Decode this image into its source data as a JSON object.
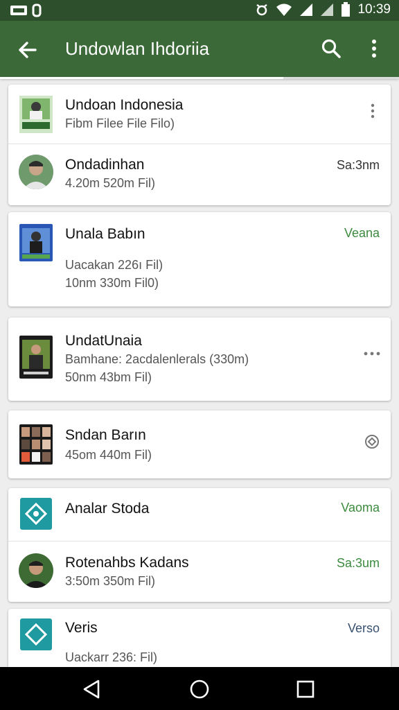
{
  "status_bar": {
    "time": "10:39",
    "icons": [
      "sim-icon",
      "sync-icon",
      "alarm-icon",
      "wifi-icon",
      "signal-icon",
      "signal-icon",
      "battery-icon"
    ]
  },
  "toolbar": {
    "title": "Undowlan Ihdoriia",
    "icons": [
      "back-arrow-icon",
      "search-icon",
      "more-vert-icon"
    ]
  },
  "progress": {
    "value": 0.71
  },
  "colors": {
    "toolbar": "#3b6a38",
    "status_bar": "#2d4f2c",
    "accent_green": "#3b8a3e",
    "accent_blue": "#37506e",
    "teal_tile": "#1f9aa0"
  },
  "cards": [
    {
      "rows": [
        {
          "title": "Undoan Indonesia",
          "sub1": "Fibm Filee File Filo)",
          "action_icon": "more-vert-icon"
        },
        {
          "title": "Ondadinhan",
          "sub1": "4.20m 520m Fil)",
          "meta": "Sa:3nm"
        }
      ]
    },
    {
      "rows": [
        {
          "title": "Unala Babın",
          "sub1": "Uacakan 226ı Fil)",
          "sub2": "10nm 330m Fil0)",
          "meta": "Veana"
        }
      ]
    },
    {
      "rows": [
        {
          "title": "UndatUnaia",
          "sub1": "Bamhane: 2acdalenlerals  (330m)",
          "sub2": "50nm 43bm Fil)",
          "action_icon": "more-horiz-icon"
        }
      ]
    },
    {
      "rows": [
        {
          "title": "Sndan Barın",
          "sub1": "45om 440m Fil)",
          "action_icon": "diamond-icon"
        }
      ]
    },
    {
      "rows": [
        {
          "title": "Analar Stoda",
          "meta": "Vaoma"
        },
        {
          "title": "Rotenahbs Kadans",
          "sub1": "3:50m 350m Fil)",
          "meta": "Sa:3um"
        }
      ]
    },
    {
      "rows": [
        {
          "title": "Veris",
          "sub1": "Uackarr 236: Fil)",
          "meta": "Verso"
        }
      ]
    }
  ],
  "navigation_bar": {
    "buttons": [
      "back-triangle-icon",
      "home-circle-icon",
      "recents-square-icon"
    ]
  }
}
